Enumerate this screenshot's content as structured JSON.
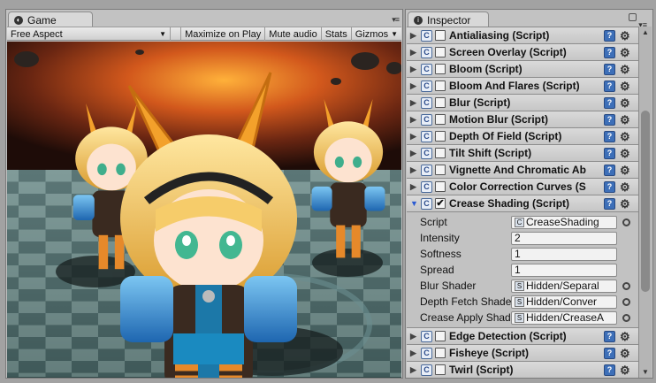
{
  "game": {
    "tab_label": "Game",
    "toolbar": {
      "aspect": "Free Aspect",
      "maximize": "Maximize on Play",
      "mute": "Mute audio",
      "stats": "Stats",
      "gizmos": "Gizmos"
    }
  },
  "inspector": {
    "tab_label": "Inspector",
    "components_top": [
      {
        "title": "Antialiasing (Script)",
        "enabled": false
      },
      {
        "title": "Screen Overlay (Script)",
        "enabled": false
      },
      {
        "title": "Bloom (Script)",
        "enabled": false
      },
      {
        "title": "Bloom And Flares (Script)",
        "enabled": false
      },
      {
        "title": "Blur (Script)",
        "enabled": false
      },
      {
        "title": "Motion Blur (Script)",
        "enabled": false
      },
      {
        "title": "Depth Of Field (Script)",
        "enabled": false
      },
      {
        "title": "Tilt Shift (Script)",
        "enabled": false
      },
      {
        "title": "Vignette And Chromatic Ab",
        "enabled": false
      },
      {
        "title": "Color Correction Curves (S",
        "enabled": false
      }
    ],
    "expanded": {
      "title": "Crease Shading (Script)",
      "enabled": true,
      "properties": [
        {
          "label": "Script",
          "value": "CreaseShading",
          "kind": "object"
        },
        {
          "label": "Intensity",
          "value": "2",
          "kind": "number"
        },
        {
          "label": "Softness",
          "value": "1",
          "kind": "number"
        },
        {
          "label": "Spread",
          "value": "1",
          "kind": "number"
        },
        {
          "label": "Blur Shader",
          "value": "Hidden/Separal",
          "kind": "object"
        },
        {
          "label": "Depth Fetch Shader",
          "value": "Hidden/Conver",
          "kind": "object"
        },
        {
          "label": "Crease Apply Shade",
          "value": "Hidden/CreaseA",
          "kind": "object"
        }
      ]
    },
    "components_bottom": [
      {
        "title": "Edge Detection (Script)",
        "enabled": false
      },
      {
        "title": "Fisheye (Script)",
        "enabled": false
      },
      {
        "title": "Twirl (Script)",
        "enabled": false
      }
    ]
  }
}
